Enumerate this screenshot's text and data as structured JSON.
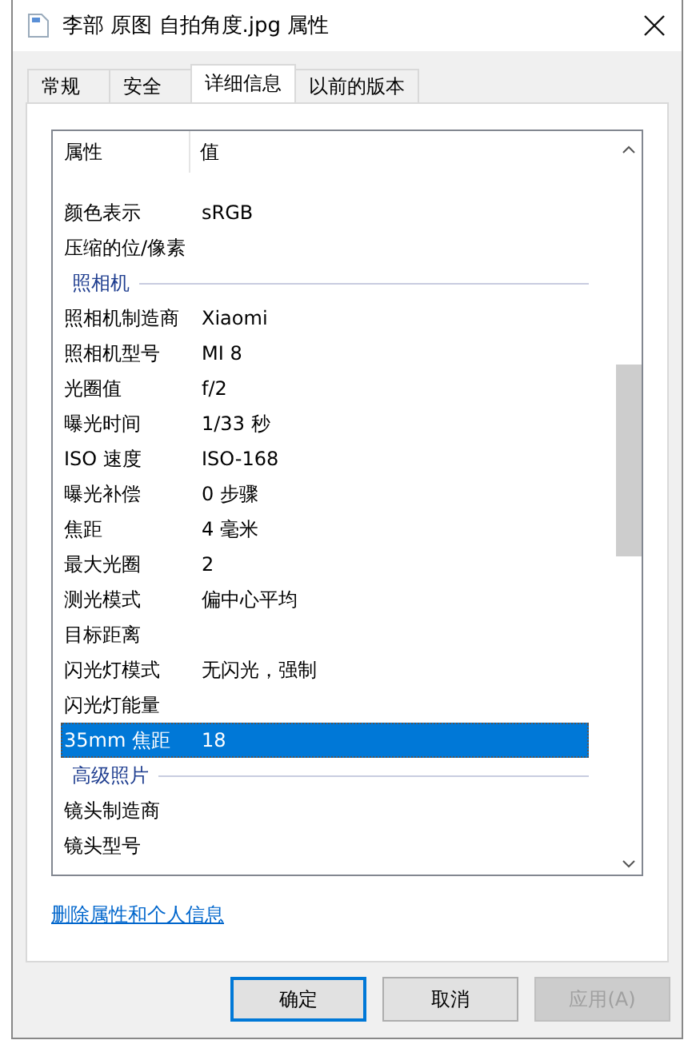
{
  "window": {
    "title": "李部 原图 自拍角度.jpg 属性"
  },
  "tabs": [
    {
      "label": "常规",
      "selected": false
    },
    {
      "label": "安全",
      "selected": false
    },
    {
      "label": "详细信息",
      "selected": true
    },
    {
      "label": "以前的版本",
      "selected": false
    }
  ],
  "table": {
    "columns": [
      "属性",
      "值"
    ],
    "rows": [
      {
        "kind": "row",
        "name": "颜色表示",
        "value": "sRGB",
        "selected": false
      },
      {
        "kind": "row",
        "name": "压缩的位/像素",
        "selected": false
      },
      {
        "kind": "group",
        "name": "照相机"
      },
      {
        "kind": "row",
        "name": "照相机制造商",
        "value": "Xiaomi",
        "selected": false
      },
      {
        "kind": "row",
        "name": "照相机型号",
        "value": "MI 8",
        "selected": false
      },
      {
        "kind": "row",
        "name": "光圈值",
        "value": "f/2",
        "selected": false
      },
      {
        "kind": "row",
        "name": "曝光时间",
        "value": "1/33 秒",
        "selected": false
      },
      {
        "kind": "row",
        "name": "ISO 速度",
        "value": "ISO-168",
        "selected": false
      },
      {
        "kind": "row",
        "name": "曝光补偿",
        "value": "0 步骤",
        "selected": false
      },
      {
        "kind": "row",
        "name": "焦距",
        "value": "4 毫米",
        "selected": false
      },
      {
        "kind": "row",
        "name": "最大光圈",
        "value": "2",
        "selected": false
      },
      {
        "kind": "row",
        "name": "测光模式",
        "value": "偏中心平均",
        "selected": false
      },
      {
        "kind": "row",
        "name": "目标距离",
        "selected": false
      },
      {
        "kind": "row",
        "name": "闪光灯模式",
        "value": "无闪光，强制",
        "selected": false
      },
      {
        "kind": "row",
        "name": "闪光灯能量",
        "selected": false
      },
      {
        "kind": "row",
        "name": "35mm 焦距",
        "value": "18",
        "selected": true
      },
      {
        "kind": "group",
        "name": "高级照片"
      },
      {
        "kind": "row",
        "name": "镜头制造商",
        "selected": false
      },
      {
        "kind": "row",
        "name": "镜头型号",
        "selected": false
      }
    ]
  },
  "link": "删除属性和个人信息",
  "buttons": [
    {
      "label": "确定",
      "default": true,
      "disabled": false
    },
    {
      "label": "取消",
      "default": false,
      "disabled": false
    },
    {
      "label": "应用(A)",
      "default": false,
      "disabled": true
    }
  ]
}
